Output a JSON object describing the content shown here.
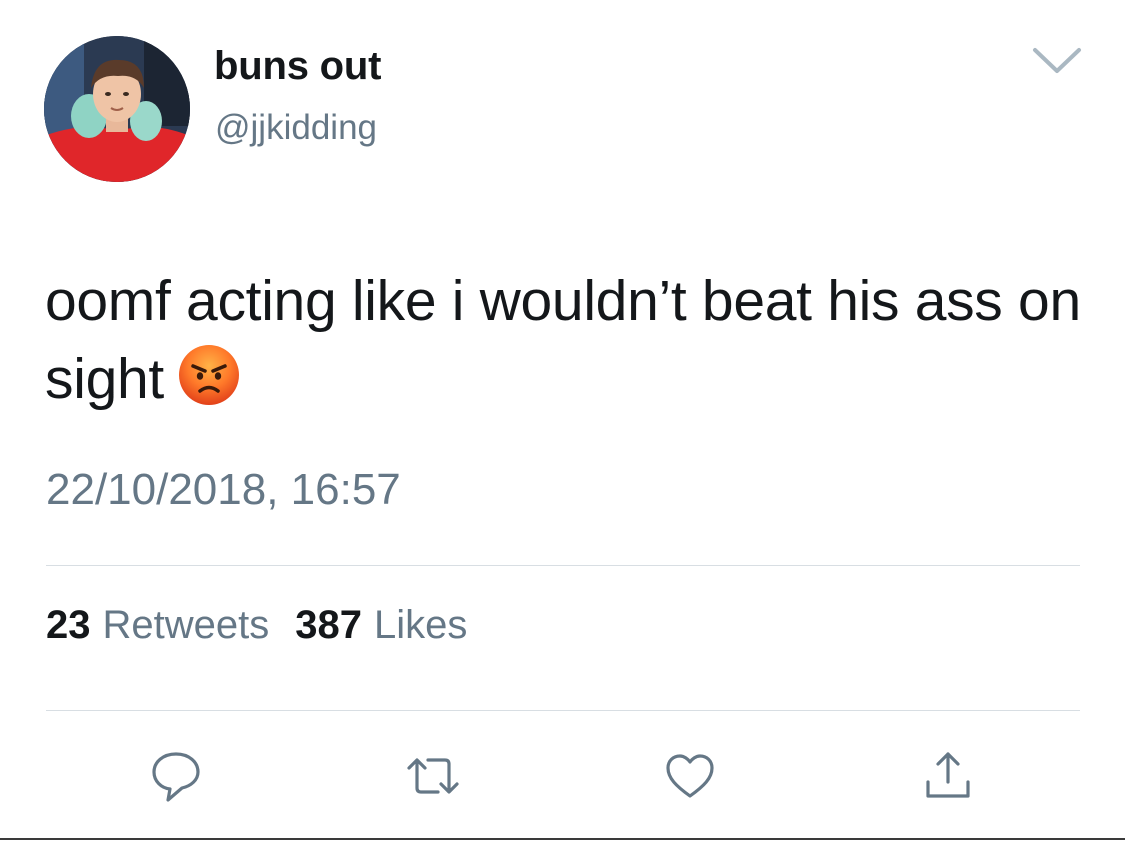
{
  "user": {
    "display_name": "buns out",
    "handle": "@jjkidding"
  },
  "tweet": {
    "text": "oomf acting like i wouldn’t beat his ass on sight",
    "emoji_icon": "angry-face-icon",
    "timestamp": "22/10/2018, 16:57"
  },
  "stats": {
    "retweets_count": "23",
    "retweets_label": "Retweets",
    "likes_count": "387",
    "likes_label": "Likes"
  },
  "actions": [
    {
      "icon": "reply-icon"
    },
    {
      "icon": "retweet-icon"
    },
    {
      "icon": "heart-icon"
    },
    {
      "icon": "share-icon"
    }
  ],
  "colors": {
    "text_primary": "#14171a",
    "text_secondary": "#657786",
    "divider": "#d8dee3",
    "icon": "#657786"
  }
}
